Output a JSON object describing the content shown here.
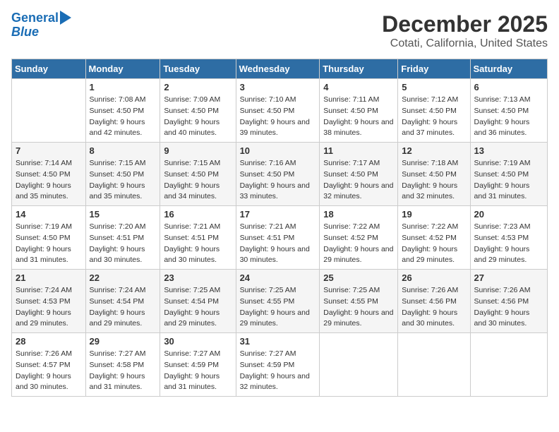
{
  "header": {
    "logo_line1": "General",
    "logo_line2": "Blue",
    "title": "December 2025",
    "subtitle": "Cotati, California, United States"
  },
  "columns": [
    "Sunday",
    "Monday",
    "Tuesday",
    "Wednesday",
    "Thursday",
    "Friday",
    "Saturday"
  ],
  "weeks": [
    [
      {
        "day": "",
        "sunrise": "",
        "sunset": "",
        "daylight": ""
      },
      {
        "day": "1",
        "sunrise": "Sunrise: 7:08 AM",
        "sunset": "Sunset: 4:50 PM",
        "daylight": "Daylight: 9 hours and 42 minutes."
      },
      {
        "day": "2",
        "sunrise": "Sunrise: 7:09 AM",
        "sunset": "Sunset: 4:50 PM",
        "daylight": "Daylight: 9 hours and 40 minutes."
      },
      {
        "day": "3",
        "sunrise": "Sunrise: 7:10 AM",
        "sunset": "Sunset: 4:50 PM",
        "daylight": "Daylight: 9 hours and 39 minutes."
      },
      {
        "day": "4",
        "sunrise": "Sunrise: 7:11 AM",
        "sunset": "Sunset: 4:50 PM",
        "daylight": "Daylight: 9 hours and 38 minutes."
      },
      {
        "day": "5",
        "sunrise": "Sunrise: 7:12 AM",
        "sunset": "Sunset: 4:50 PM",
        "daylight": "Daylight: 9 hours and 37 minutes."
      },
      {
        "day": "6",
        "sunrise": "Sunrise: 7:13 AM",
        "sunset": "Sunset: 4:50 PM",
        "daylight": "Daylight: 9 hours and 36 minutes."
      }
    ],
    [
      {
        "day": "7",
        "sunrise": "Sunrise: 7:14 AM",
        "sunset": "Sunset: 4:50 PM",
        "daylight": "Daylight: 9 hours and 35 minutes."
      },
      {
        "day": "8",
        "sunrise": "Sunrise: 7:15 AM",
        "sunset": "Sunset: 4:50 PM",
        "daylight": "Daylight: 9 hours and 35 minutes."
      },
      {
        "day": "9",
        "sunrise": "Sunrise: 7:15 AM",
        "sunset": "Sunset: 4:50 PM",
        "daylight": "Daylight: 9 hours and 34 minutes."
      },
      {
        "day": "10",
        "sunrise": "Sunrise: 7:16 AM",
        "sunset": "Sunset: 4:50 PM",
        "daylight": "Daylight: 9 hours and 33 minutes."
      },
      {
        "day": "11",
        "sunrise": "Sunrise: 7:17 AM",
        "sunset": "Sunset: 4:50 PM",
        "daylight": "Daylight: 9 hours and 32 minutes."
      },
      {
        "day": "12",
        "sunrise": "Sunrise: 7:18 AM",
        "sunset": "Sunset: 4:50 PM",
        "daylight": "Daylight: 9 hours and 32 minutes."
      },
      {
        "day": "13",
        "sunrise": "Sunrise: 7:19 AM",
        "sunset": "Sunset: 4:50 PM",
        "daylight": "Daylight: 9 hours and 31 minutes."
      }
    ],
    [
      {
        "day": "14",
        "sunrise": "Sunrise: 7:19 AM",
        "sunset": "Sunset: 4:50 PM",
        "daylight": "Daylight: 9 hours and 31 minutes."
      },
      {
        "day": "15",
        "sunrise": "Sunrise: 7:20 AM",
        "sunset": "Sunset: 4:51 PM",
        "daylight": "Daylight: 9 hours and 30 minutes."
      },
      {
        "day": "16",
        "sunrise": "Sunrise: 7:21 AM",
        "sunset": "Sunset: 4:51 PM",
        "daylight": "Daylight: 9 hours and 30 minutes."
      },
      {
        "day": "17",
        "sunrise": "Sunrise: 7:21 AM",
        "sunset": "Sunset: 4:51 PM",
        "daylight": "Daylight: 9 hours and 30 minutes."
      },
      {
        "day": "18",
        "sunrise": "Sunrise: 7:22 AM",
        "sunset": "Sunset: 4:52 PM",
        "daylight": "Daylight: 9 hours and 29 minutes."
      },
      {
        "day": "19",
        "sunrise": "Sunrise: 7:22 AM",
        "sunset": "Sunset: 4:52 PM",
        "daylight": "Daylight: 9 hours and 29 minutes."
      },
      {
        "day": "20",
        "sunrise": "Sunrise: 7:23 AM",
        "sunset": "Sunset: 4:53 PM",
        "daylight": "Daylight: 9 hours and 29 minutes."
      }
    ],
    [
      {
        "day": "21",
        "sunrise": "Sunrise: 7:24 AM",
        "sunset": "Sunset: 4:53 PM",
        "daylight": "Daylight: 9 hours and 29 minutes."
      },
      {
        "day": "22",
        "sunrise": "Sunrise: 7:24 AM",
        "sunset": "Sunset: 4:54 PM",
        "daylight": "Daylight: 9 hours and 29 minutes."
      },
      {
        "day": "23",
        "sunrise": "Sunrise: 7:25 AM",
        "sunset": "Sunset: 4:54 PM",
        "daylight": "Daylight: 9 hours and 29 minutes."
      },
      {
        "day": "24",
        "sunrise": "Sunrise: 7:25 AM",
        "sunset": "Sunset: 4:55 PM",
        "daylight": "Daylight: 9 hours and 29 minutes."
      },
      {
        "day": "25",
        "sunrise": "Sunrise: 7:25 AM",
        "sunset": "Sunset: 4:55 PM",
        "daylight": "Daylight: 9 hours and 29 minutes."
      },
      {
        "day": "26",
        "sunrise": "Sunrise: 7:26 AM",
        "sunset": "Sunset: 4:56 PM",
        "daylight": "Daylight: 9 hours and 30 minutes."
      },
      {
        "day": "27",
        "sunrise": "Sunrise: 7:26 AM",
        "sunset": "Sunset: 4:56 PM",
        "daylight": "Daylight: 9 hours and 30 minutes."
      }
    ],
    [
      {
        "day": "28",
        "sunrise": "Sunrise: 7:26 AM",
        "sunset": "Sunset: 4:57 PM",
        "daylight": "Daylight: 9 hours and 30 minutes."
      },
      {
        "day": "29",
        "sunrise": "Sunrise: 7:27 AM",
        "sunset": "Sunset: 4:58 PM",
        "daylight": "Daylight: 9 hours and 31 minutes."
      },
      {
        "day": "30",
        "sunrise": "Sunrise: 7:27 AM",
        "sunset": "Sunset: 4:59 PM",
        "daylight": "Daylight: 9 hours and 31 minutes."
      },
      {
        "day": "31",
        "sunrise": "Sunrise: 7:27 AM",
        "sunset": "Sunset: 4:59 PM",
        "daylight": "Daylight: 9 hours and 32 minutes."
      },
      {
        "day": "",
        "sunrise": "",
        "sunset": "",
        "daylight": ""
      },
      {
        "day": "",
        "sunrise": "",
        "sunset": "",
        "daylight": ""
      },
      {
        "day": "",
        "sunrise": "",
        "sunset": "",
        "daylight": ""
      }
    ]
  ]
}
